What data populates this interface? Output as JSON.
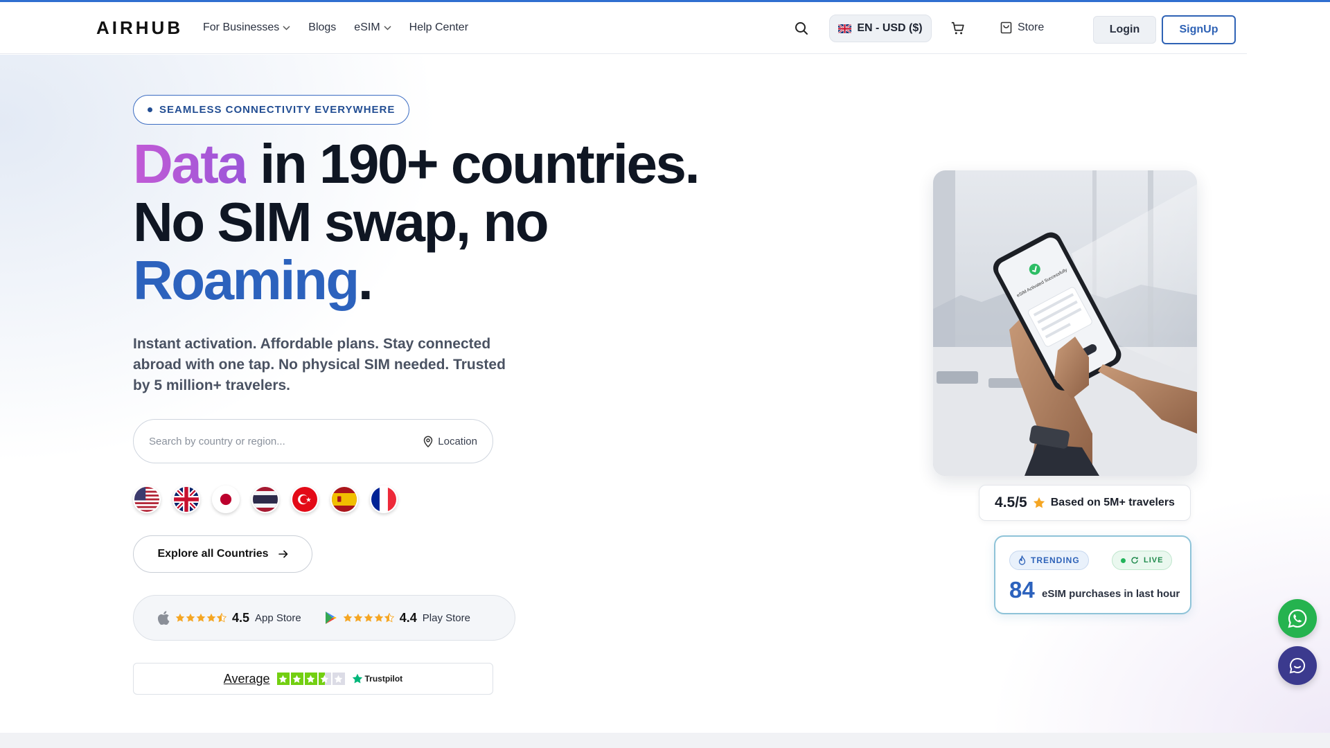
{
  "brand": {
    "logo": "AIRHUB",
    "accent": "#2f6fd0"
  },
  "nav": {
    "items": [
      {
        "label": "For Businesses",
        "dropdown": true
      },
      {
        "label": "Blogs",
        "dropdown": false
      },
      {
        "label": "eSIM",
        "dropdown": true
      },
      {
        "label": "Help Center",
        "dropdown": false
      }
    ],
    "language": "EN - USD ($)",
    "store": "Store",
    "login": "Login",
    "signup": "SignUp"
  },
  "hero": {
    "badge": "SEAMLESS CONNECTIVITY EVERYWHERE",
    "headline": {
      "word1": "Data",
      "line1_rest": " in 190+ countries.",
      "line2": "No SIM swap, no",
      "word3": "Roaming",
      "line3_end": "."
    },
    "subtext": "Instant activation. Affordable plans. Stay connected abroad with one tap. No physical SIM needed. Trusted by 5 million+ travelers.",
    "search": {
      "placeholder": "Search by country or region...",
      "location": "Location"
    },
    "flags": [
      "United States",
      "United Kingdom",
      "Japan",
      "Thailand",
      "Turkey",
      "Spain",
      "France"
    ],
    "explore": "Explore all Countries",
    "apps": {
      "app_store": {
        "rating": "4.5",
        "name": "App Store",
        "stars": 4.5
      },
      "play_store": {
        "rating": "4.4",
        "name": "Play Store",
        "stars": 4.5
      }
    },
    "trustpilot": {
      "label": "Average",
      "brand": "Trustpilot",
      "stars": 3.5
    }
  },
  "right": {
    "phone_text": "eSIM Activated Successfully",
    "rating": {
      "score": "4.5/5",
      "text": "Based on 5M+ travelers"
    },
    "trending": {
      "badge": "TRENDING",
      "live": "LIVE",
      "count": "84",
      "text": "eSIM purchases in last hour"
    }
  },
  "floating": {
    "whatsapp": "whatsapp-icon",
    "chat": "chat-icon"
  }
}
